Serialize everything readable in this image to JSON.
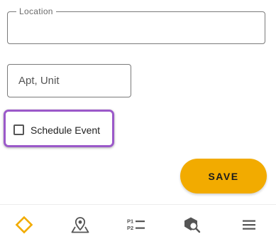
{
  "form": {
    "location": {
      "label": "Location",
      "value": ""
    },
    "apt_unit": {
      "placeholder": "Apt, Unit",
      "value": ""
    },
    "schedule_event": {
      "label": "Schedule Event",
      "checked": false
    },
    "save_label": "SAVE"
  },
  "bottom_nav": {
    "items": [
      {
        "icon": "diamond-icon",
        "active": true
      },
      {
        "icon": "map-pin-icon",
        "active": false
      },
      {
        "icon": "priority-list-icon",
        "active": false
      },
      {
        "icon": "search-cube-icon",
        "active": false
      },
      {
        "icon": "menu-icon",
        "active": false
      }
    ],
    "priority_labels": [
      "P1",
      "P2"
    ]
  },
  "colors": {
    "accent": "#f2ab00",
    "highlight_border": "#9b59c9",
    "icon_gray": "#555555"
  }
}
